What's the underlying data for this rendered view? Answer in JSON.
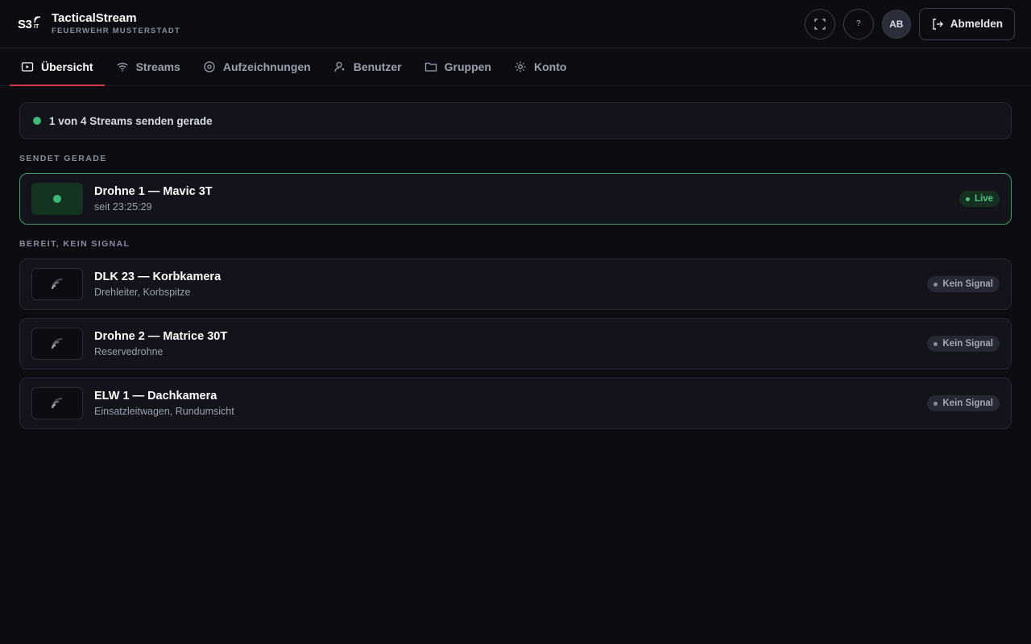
{
  "brand": {
    "logo_main": "S3",
    "logo_sub": "IT",
    "title": "TacticalStream",
    "subtitle": "FEUERWEHR MUSTERSTADT"
  },
  "header": {
    "fullscreen_icon": "fullscreen-icon",
    "help_label": "?",
    "avatar_initials": "AB",
    "logout_label": "Abmelden"
  },
  "tabs": [
    {
      "label": "Übersicht",
      "icon": "play-icon",
      "active": true
    },
    {
      "label": "Streams",
      "icon": "wifi-icon",
      "active": false
    },
    {
      "label": "Aufzeichnungen",
      "icon": "record-icon",
      "active": false
    },
    {
      "label": "Benutzer",
      "icon": "user-icon",
      "active": false
    },
    {
      "label": "Gruppen",
      "icon": "folder-icon",
      "active": false
    },
    {
      "label": "Konto",
      "icon": "gear-icon",
      "active": false
    }
  ],
  "summary": {
    "text": "1 von 4 Streams senden gerade",
    "status_color": "#3cb878"
  },
  "sections": {
    "live_title": "SENDET GERADE",
    "idle_title": "BEREIT, KEIN SIGNAL"
  },
  "live_streams": [
    {
      "name": "Drohne 1 — Mavic 3T",
      "meta": "seit 23:25:29",
      "badge": "Live"
    }
  ],
  "idle_streams": [
    {
      "name": "DLK 23 — Korbkamera",
      "meta": "Drehleiter, Korbspitze",
      "badge": "Kein Signal"
    },
    {
      "name": "Drohne 2 — Matrice 30T",
      "meta": "Reservedrohne",
      "badge": "Kein Signal"
    },
    {
      "name": "ELW 1 — Dachkamera",
      "meta": "Einsatzleitwagen, Rundumsicht",
      "badge": "Kein Signal"
    }
  ],
  "colors": {
    "accent": "#d63a4a",
    "live": "#3cb878",
    "background": "#0c0d12"
  }
}
